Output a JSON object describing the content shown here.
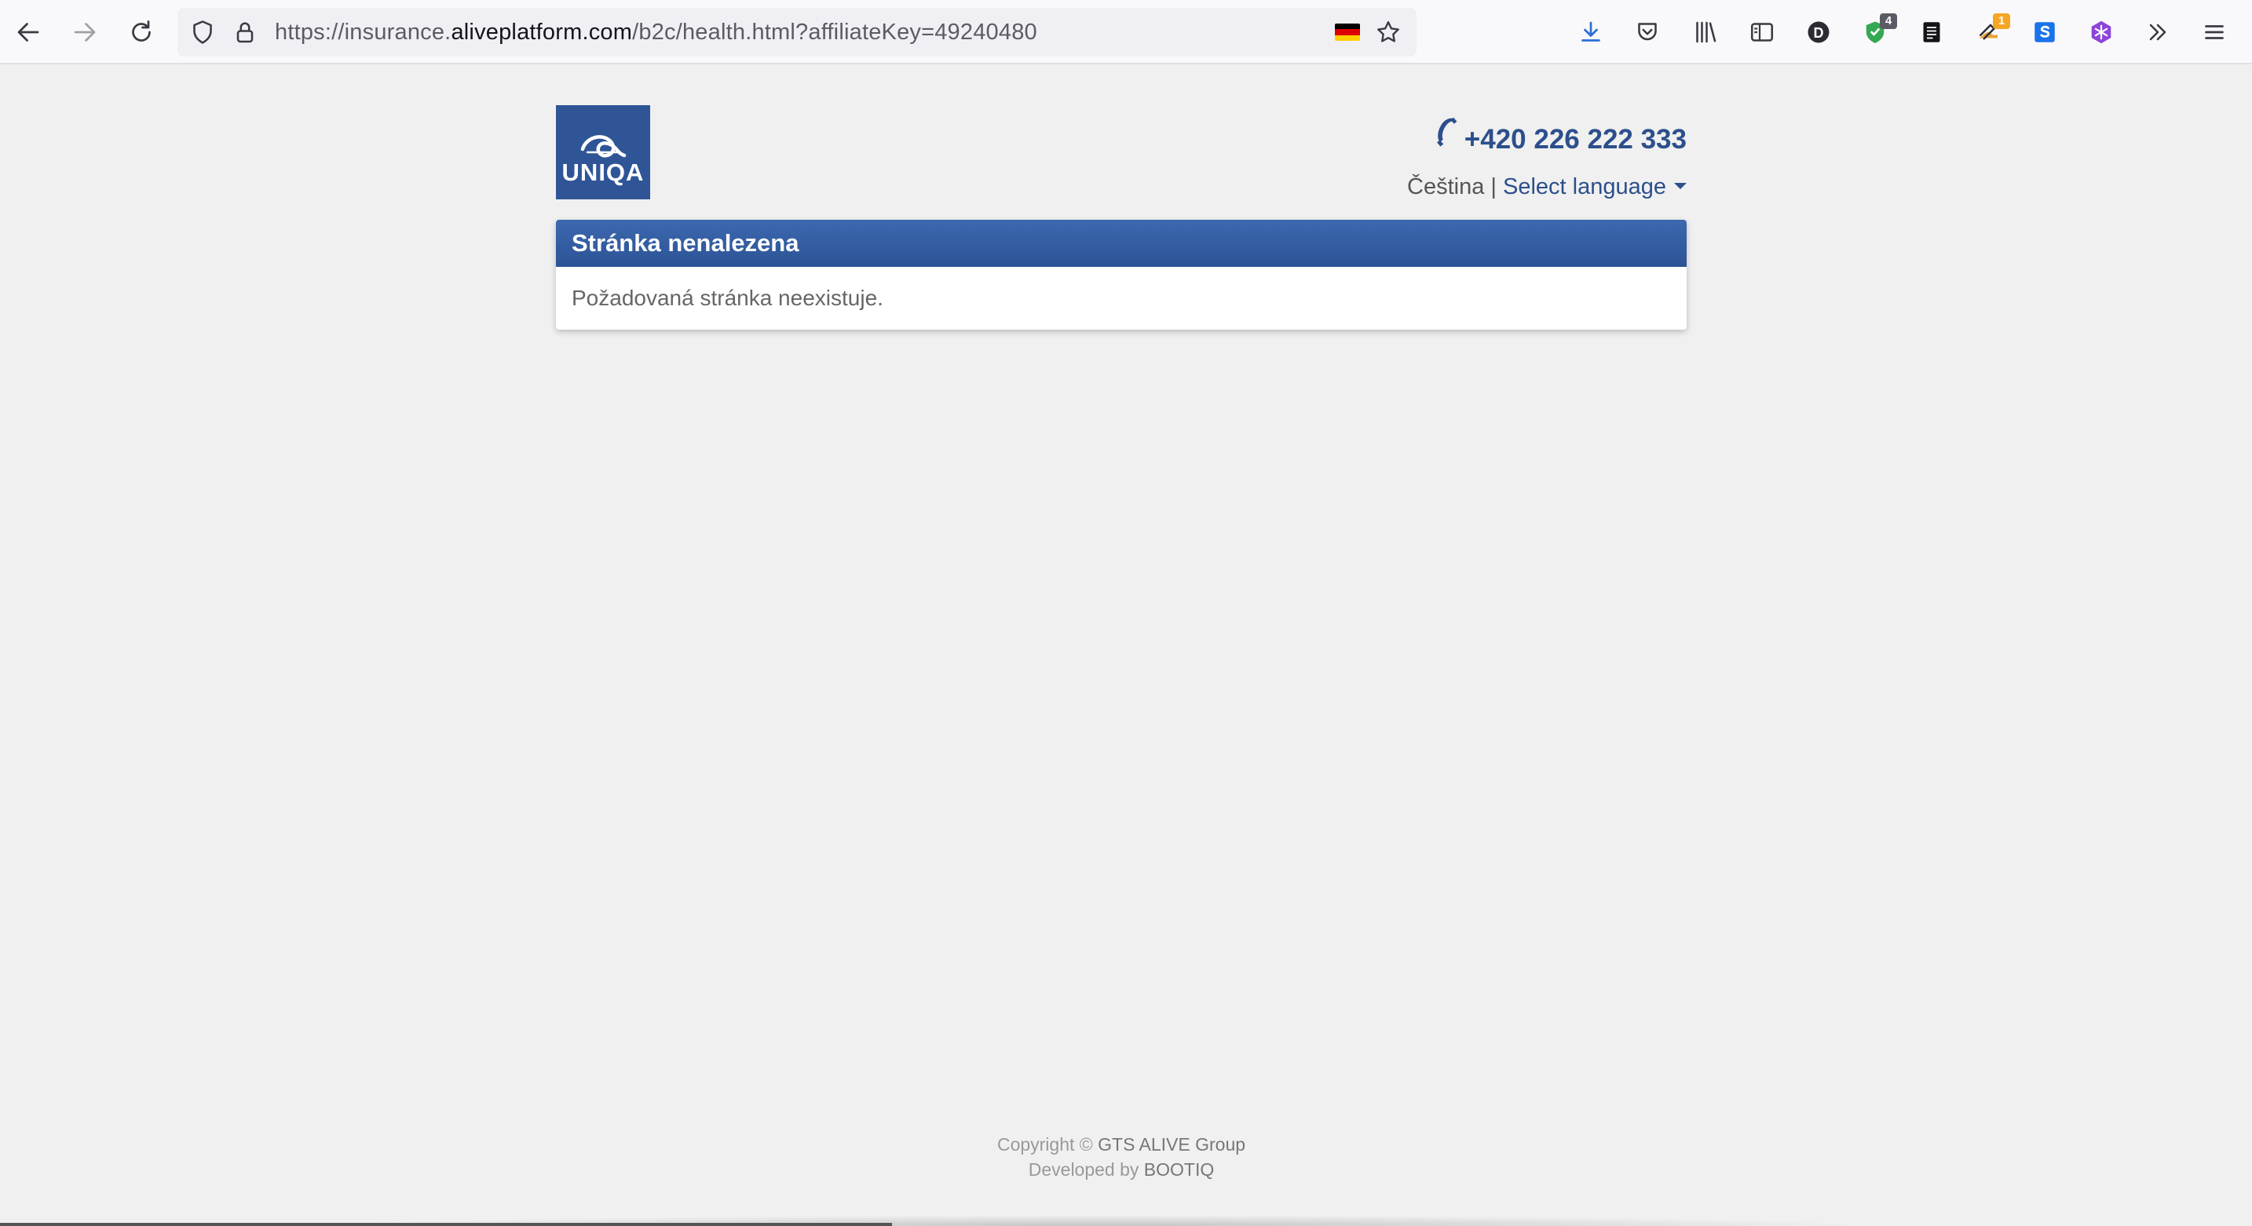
{
  "browser": {
    "url_prefix": "https://insurance.",
    "url_domain": "aliveplatform.com",
    "url_path": "/b2c/health.html?affiliateKey=49240480",
    "shield_badge": "4",
    "ext_badge": "1",
    "avatar_letter": "D",
    "icons": [
      "back-icon",
      "forward-icon",
      "reload-icon",
      "tracking-shield-icon",
      "lock-icon",
      "flag-de-icon",
      "bookmark-star-icon",
      "download-icon",
      "pocket-icon",
      "library-icon",
      "sidebar-icon",
      "account-icon",
      "ublock-icon",
      "notes-icon",
      "extension-icon",
      "s-extension-icon",
      "snowflake-icon",
      "overflow-icon",
      "menu-icon"
    ]
  },
  "header": {
    "logo_text": "UNIQA",
    "phone": "+420 226 222 333",
    "current_language": "Čeština",
    "separator": "|",
    "select_language": "Select language"
  },
  "panel": {
    "title": "Stránka nenalezena",
    "message": "Požadovaná stránka neexistuje."
  },
  "footer": {
    "copyright_prefix": "Copyright © ",
    "copyright_owner": "GTS ALIVE Group",
    "developed_prefix": "Developed by ",
    "developer": "BOOTIQ"
  },
  "colors": {
    "brand": "#2f5597",
    "link": "#2c4f8c",
    "page_bg": "#f0f0f0"
  }
}
